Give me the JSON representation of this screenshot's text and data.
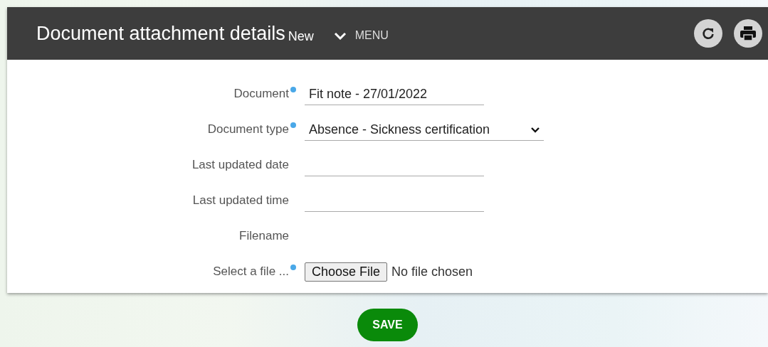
{
  "header": {
    "title": "Document attachment details",
    "status": "New",
    "menu_label": "MENU"
  },
  "fields": [
    {
      "kind": "text",
      "label": "Document",
      "required": true,
      "value": "Fit note - 27/01/2022"
    },
    {
      "kind": "select",
      "label": "Document type",
      "required": true,
      "value": "Absence - Sickness certification"
    },
    {
      "kind": "text",
      "label": "Last updated date",
      "required": false
    },
    {
      "kind": "text",
      "label": "Last updated time",
      "required": false
    },
    {
      "kind": "static",
      "label": "Filename",
      "required": false
    },
    {
      "kind": "file",
      "label": "Select a file ...",
      "required": true,
      "button": "Choose File",
      "value": "No file chosen"
    }
  ],
  "save_button": "SAVE"
}
